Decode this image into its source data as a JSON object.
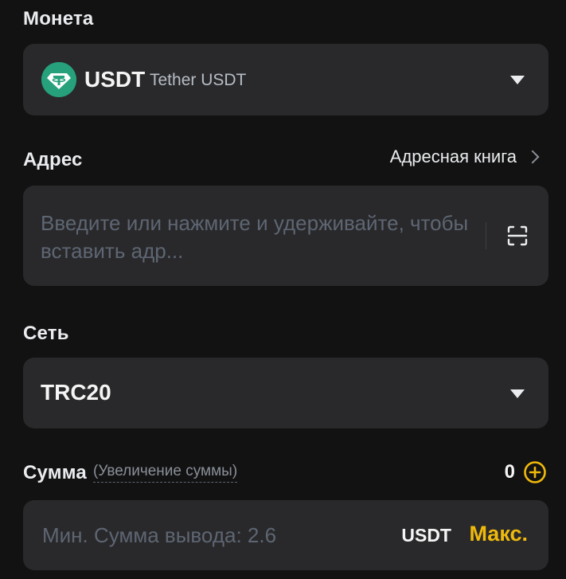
{
  "coin": {
    "label": "Монета",
    "symbol": "USDT",
    "name": "Tether USDT",
    "icon": "tether-icon",
    "logo_color": "#26a17b"
  },
  "address": {
    "label": "Адрес",
    "address_book_label": "Адресная книга",
    "placeholder": "Введите или нажмите и удерживайте, чтобы вставить адр...",
    "scan_icon": "scan-icon"
  },
  "network": {
    "label": "Сеть",
    "value": "TRC20"
  },
  "amount": {
    "label": "Сумма",
    "hint": "(Увеличение суммы)",
    "balance": "0",
    "placeholder": "Мин. Сумма вывода: 2.6",
    "unit": "USDT",
    "max_label": "Макс.",
    "accent_color": "#f0b90b"
  }
}
